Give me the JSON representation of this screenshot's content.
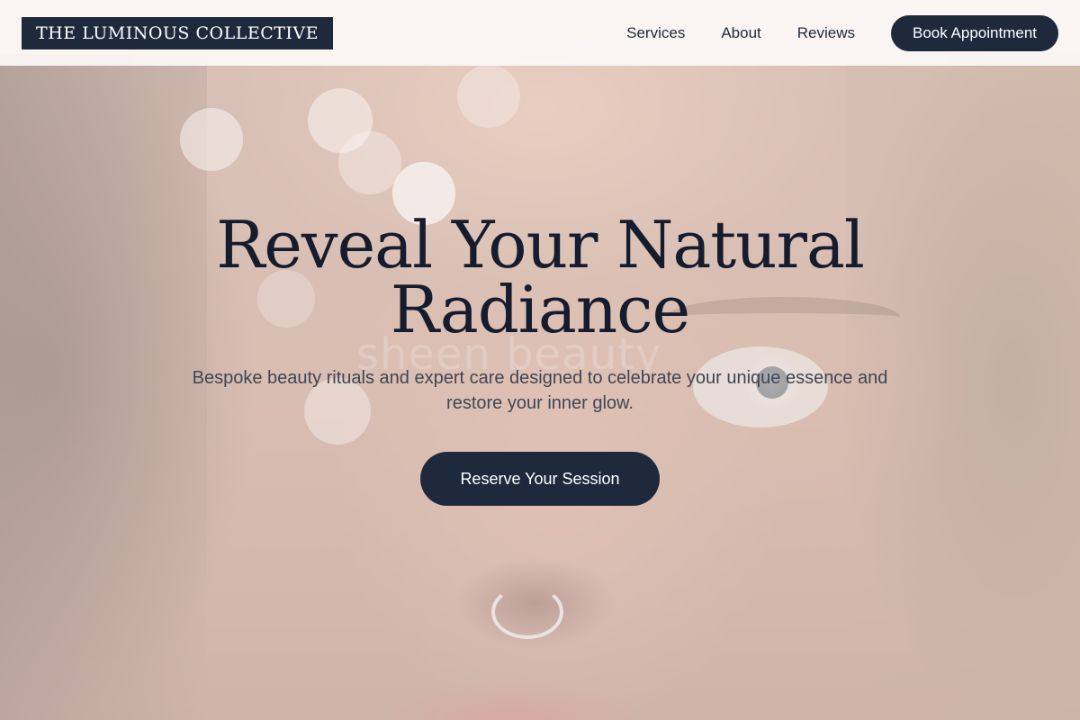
{
  "header": {
    "logo_text": "THE LUMINOUS COLLECTIVE",
    "nav_links": [
      {
        "label": "Services"
      },
      {
        "label": "About"
      },
      {
        "label": "Reviews"
      }
    ],
    "cta_label": "Book Appointment"
  },
  "hero": {
    "headline": "Reveal Your Natural Radiance",
    "subtext": "Bespoke beauty rituals and expert care designed to celebrate your unique essence and restore your inner glow.",
    "cta_label": "Reserve Your Session",
    "background_watermark": "sheen beauty"
  },
  "colors": {
    "primary": "#1e293b",
    "headline_text": "#151c2e",
    "body_text": "#3f4656",
    "nav_background": "#fcf9f7"
  }
}
